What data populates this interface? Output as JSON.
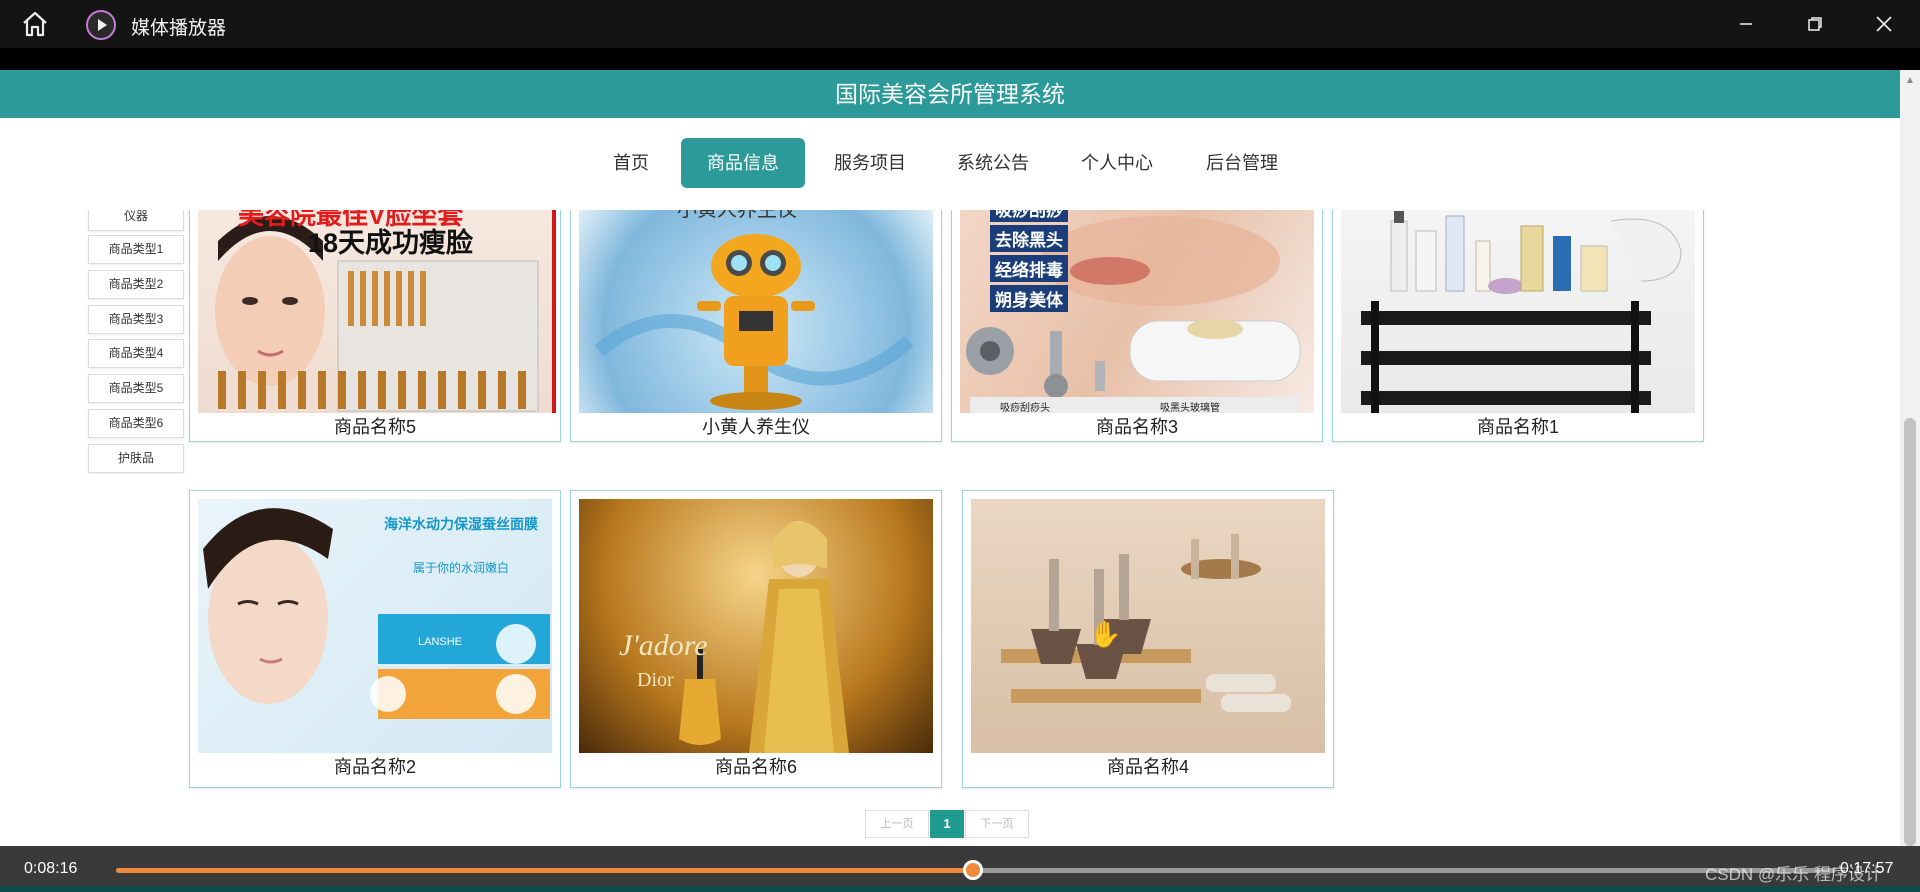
{
  "player": {
    "title": "媒体播放器",
    "current_time": "0:08:16",
    "total_time": "0:17:57",
    "progress": 0.498,
    "watermark": "CSDN @乐乐 程序设计",
    "accent": "#f08a3a"
  },
  "site": {
    "title": "国际美容会所管理系统",
    "brand_color": "#2b9a99",
    "nav": [
      {
        "label": "首页"
      },
      {
        "label": "商品信息",
        "active": true
      },
      {
        "label": "服务项目"
      },
      {
        "label": "系统公告"
      },
      {
        "label": "个人中心"
      },
      {
        "label": "后台管理"
      }
    ]
  },
  "sidebar": {
    "items": [
      {
        "label": "仪器"
      },
      {
        "label": "商品类型1"
      },
      {
        "label": "商品类型2"
      },
      {
        "label": "商品类型3"
      },
      {
        "label": "商品类型4"
      },
      {
        "label": "商品类型5"
      },
      {
        "label": "商品类型6"
      },
      {
        "label": "护肤品"
      }
    ]
  },
  "products": [
    {
      "name": "商品名称5",
      "image_text": [
        "美容院最佳V脸坐套",
        "18天成功瘦脸"
      ]
    },
    {
      "name": "小黄人养生仪",
      "image_text": [
        "小黄人养生仪"
      ]
    },
    {
      "name": "商品名称3",
      "image_text": [
        "吸痧刮痧",
        "去除黑头",
        "经络排毒",
        "朔身美体",
        "吸痧刮痧头",
        "吸黑头玻璃管"
      ]
    },
    {
      "name": "商品名称1",
      "image_text": []
    },
    {
      "name": "商品名称2",
      "image_text": [
        "海洋水动力保湿蚕丝面膜",
        "属于你的水润嫩白",
        "LANSHE"
      ]
    },
    {
      "name": "商品名称6",
      "image_text": [
        "J'adore",
        "Dior"
      ]
    },
    {
      "name": "商品名称4",
      "image_text": []
    }
  ],
  "pager": {
    "prev": "上一页",
    "current": "1",
    "next": "下一页"
  }
}
